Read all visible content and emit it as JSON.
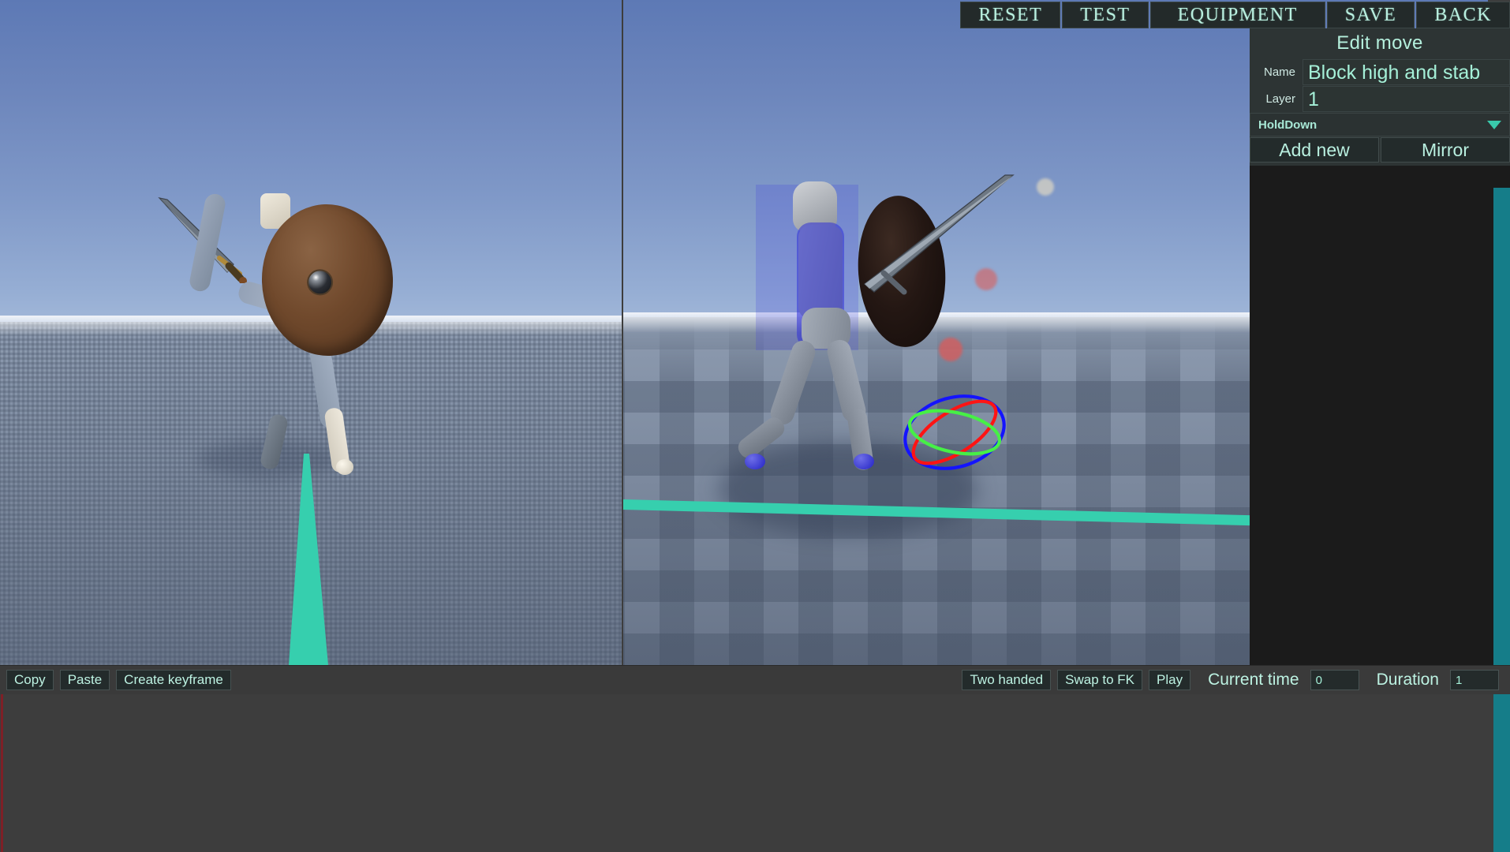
{
  "header": {
    "buttons": [
      {
        "label": "RESET",
        "name": "reset-button"
      },
      {
        "label": "TEST",
        "name": "test-button"
      },
      {
        "label": "EQUIPMENT",
        "name": "equipment-button"
      },
      {
        "label": "SAVE",
        "name": "save-button"
      },
      {
        "label": "BACK",
        "name": "back-button"
      }
    ]
  },
  "panel": {
    "title": "Edit move",
    "name_label": "Name",
    "name_value": "Block high and stab",
    "layer_label": "Layer",
    "layer_value": "1",
    "dropdown_value": "HoldDown",
    "dropdown_icon": "chevron-down-icon",
    "add_new_label": "Add new",
    "mirror_label": "Mirror"
  },
  "toolbar": {
    "copy_label": "Copy",
    "paste_label": "Paste",
    "create_keyframe_label": "Create keyframe",
    "two_handed_label": "Two handed",
    "swap_to_fk_label": "Swap to FK",
    "play_label": "Play",
    "current_time_label": "Current time",
    "current_time_value": "0",
    "duration_label": "Duration",
    "duration_value": "1"
  },
  "colors": {
    "accent_teal": "#36cfae",
    "panel_bg": "#1b1b1b",
    "toolbar_bg": "#3a3a3a",
    "timeline_bg": "#3d3d3d",
    "text_mint": "#b9f0e0",
    "strip_teal": "#157d89",
    "playhead_red": "#7e2027",
    "gizmo_x": "#ff1f1f",
    "gizmo_y": "#3cf03c",
    "gizmo_z": "#1f1fff"
  },
  "viewports": {
    "left_label": "perspective-front-view",
    "right_label": "perspective-pose-view"
  }
}
